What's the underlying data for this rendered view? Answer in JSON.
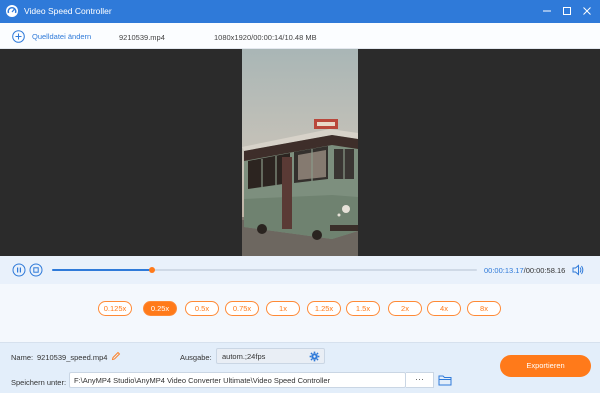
{
  "window": {
    "title": "Video Speed Controller",
    "icon": "speedometer-icon",
    "buttons": [
      "minimize",
      "maximize",
      "close"
    ]
  },
  "toolbar": {
    "add_source_label": "Quelldatei ändern",
    "file_name": "9210539.mp4",
    "file_info": "1080x1920/00:00:14/10.48 MB"
  },
  "player": {
    "current_time": "00:00:13.17",
    "total_time": "/00:00:58.16",
    "progress": 0.236
  },
  "speeds": {
    "options": [
      "0.125x",
      "0.25x",
      "0.5x",
      "0.75x",
      "1x",
      "1.25x",
      "1.5x",
      "2x",
      "4x",
      "8x"
    ],
    "selected": "0.25x"
  },
  "output": {
    "name_label": "Name:",
    "name_value": "9210539_speed.mp4",
    "format_label": "Ausgabe:",
    "format_value": "autom.;24fps",
    "save_label": "Speichern unter:",
    "save_path": "F:\\AnyMP4 Studio\\AnyMP4 Video Converter Ultimate\\Video Speed Controller",
    "browse_label": "···",
    "export_label": "Exportieren"
  },
  "colors": {
    "accent": "#2f7ad9",
    "orange": "#ff7a1a"
  }
}
